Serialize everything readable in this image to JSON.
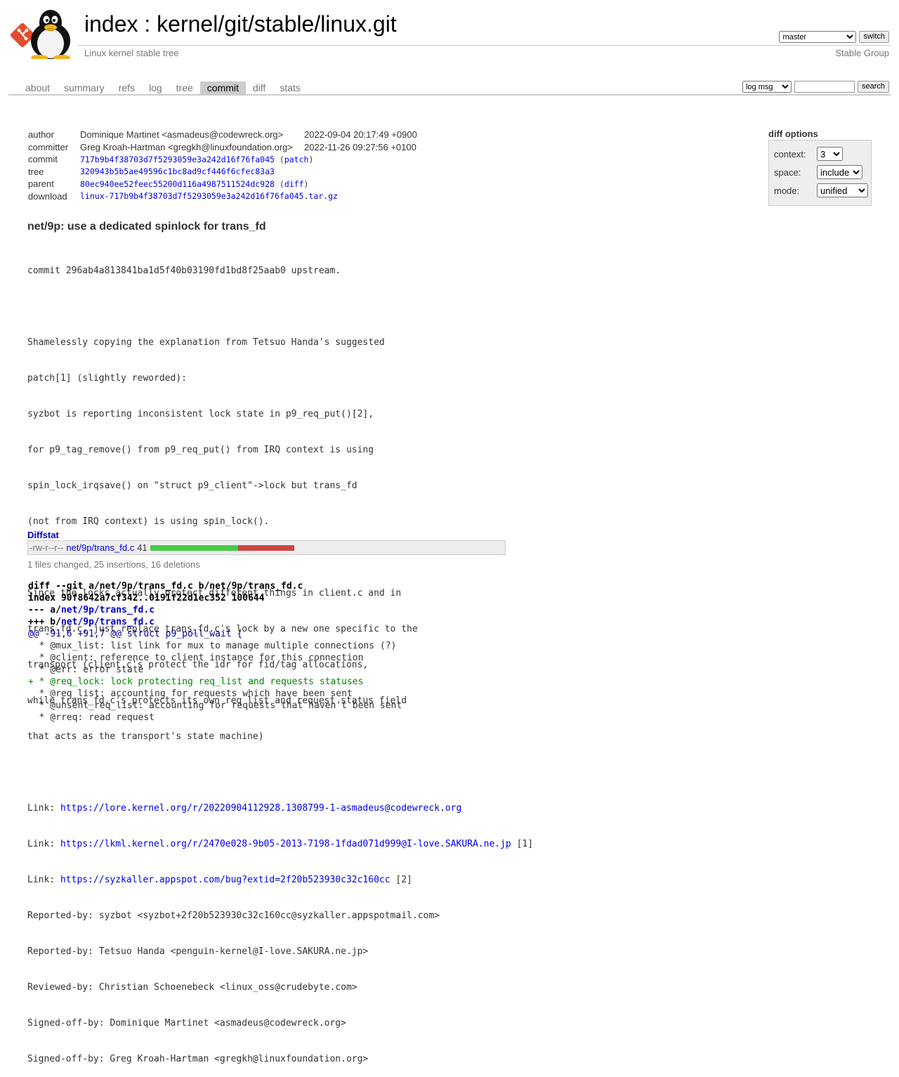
{
  "header": {
    "title_index": "index",
    "title_sep": " : ",
    "title_repo": "kernel/git/stable/linux.git",
    "subtitle": "Linux kernel stable tree",
    "owner": "Stable Group",
    "branch_selected": "master",
    "switch_label": "switch"
  },
  "tabs": [
    {
      "label": "about"
    },
    {
      "label": "summary"
    },
    {
      "label": "refs"
    },
    {
      "label": "log"
    },
    {
      "label": "tree"
    },
    {
      "label": "commit"
    },
    {
      "label": "diff"
    },
    {
      "label": "stats"
    }
  ],
  "active_tab": "commit",
  "search": {
    "mode_selected": "log msg",
    "query": "",
    "button_label": "search"
  },
  "commit_info": {
    "author_label": "author",
    "author": "Dominique Martinet <asmadeus@codewreck.org>",
    "author_date": "2022-09-04 20:17:49 +0900",
    "committer_label": "committer",
    "committer": "Greg Kroah-Hartman <gregkh@linuxfoundation.org>",
    "committer_date": "2022-11-26 09:27:56 +0100",
    "commit_label": "commit",
    "commit_sha": "717b9b4f38703d7f5293059e3a242d16f76fa045",
    "patch_link": "patch",
    "tree_label": "tree",
    "tree_sha": "320943b5b5ae49596c1bc8ad9cf446f6cfec83a3",
    "parent_label": "parent",
    "parent_sha": "80ec940ee52feec55200d116a4987511524dc928",
    "diff_link": "diff",
    "download_label": "download",
    "download_file": "linux-717b9b4f38703d7f5293059e3a242d16f76fa045.tar.gz"
  },
  "diff_options": {
    "title": "diff options",
    "context_label": "context:",
    "context_value": "3",
    "space_label": "space:",
    "space_value": "include",
    "mode_label": "mode:",
    "mode_value": "unified"
  },
  "message": {
    "subject": "net/9p: use a dedicated spinlock for trans_fd",
    "body_lines": [
      "commit 296ab4a813841ba1d5f40b03190fd1bd8f25aab0 upstream.",
      "",
      "Shamelessly copying the explanation from Tetsuo Handa's suggested",
      "patch[1] (slightly reworded):",
      "syzbot is reporting inconsistent lock state in p9_req_put()[2],",
      "for p9_tag_remove() from p9_req_put() from IRQ context is using",
      "spin_lock_irqsave() on \"struct p9_client\"->lock but trans_fd",
      "(not from IRQ context) is using spin_lock().",
      "",
      "Since the locks actually protect different things in client.c and in",
      "trans_fd.c, just replace trans_fd.c's lock by a new one specific to the",
      "transport (client.c's protect the idr for fid/tag allocations,",
      "while trans_fd.c's protects its own req list and request status field",
      "that acts as the transport's state machine)",
      ""
    ],
    "links": [
      {
        "prefix": "Link: ",
        "url": "https://lore.kernel.org/r/20220904112928.1308799-1-asmadeus@codewreck.org",
        "suffix": ""
      },
      {
        "prefix": "Link: ",
        "url": "https://lkml.kernel.org/r/2470e028-9b05-2013-7198-1fdad071d999@I-love.SAKURA.ne.jp",
        "suffix": " [1]"
      },
      {
        "prefix": "Link: ",
        "url": "https://syzkaller.appspot.com/bug?extid=2f20b523930c32c160cc",
        "suffix": " [2]"
      }
    ],
    "trailer_lines": [
      "Reported-by: syzbot <syzbot+2f20b523930c32c160cc@syzkaller.appspotmail.com>",
      "Reported-by: Tetsuo Handa <penguin-kernel@I-love.SAKURA.ne.jp>",
      "Reviewed-by: Christian Schoenebeck <linux_oss@crudebyte.com>",
      "Signed-off-by: Dominique Martinet <asmadeus@codewreck.org>",
      "Signed-off-by: Greg Kroah-Hartman <gregkh@linuxfoundation.org>"
    ]
  },
  "diffstat": {
    "header": "Diffstat",
    "mode": "-rw-r--r--",
    "file": "net/9p/trans_fd.c",
    "changes": "41",
    "insertions": 25,
    "deletions": 16,
    "summary": "1 files changed, 25 insertions, 16 deletions",
    "colors": {
      "insert": "#44cc44",
      "delete": "#cc4444"
    }
  },
  "diff": {
    "git_line": "diff --git a/net/9p/trans_fd.c b/net/9p/trans_fd.c",
    "index_line": "index 90f8642a7cf342..0191f22d1ec352 100644",
    "old_prefix": "--- a/",
    "new_prefix": "+++ b/",
    "file_path": "net/9p/trans_fd.c",
    "hunk": "@@ -91,6 +91,7 @@ struct p9_poll_wait {",
    "lines": [
      {
        "type": "ctx",
        "text": "  * @mux_list: list link for mux to manage multiple connections (?)"
      },
      {
        "type": "ctx",
        "text": "  * @client: reference to client instance for this connection"
      },
      {
        "type": "ctx",
        "text": "  * @err: error state"
      },
      {
        "type": "add",
        "text": "+ * @req_lock: lock protecting req_list and requests statuses"
      },
      {
        "type": "ctx",
        "text": "  * @req_list: accounting for requests which have been sent"
      },
      {
        "type": "ctx",
        "text": "  * @unsent_req_list: accounting for requests that haven't been sent"
      },
      {
        "type": "ctx",
        "text": "  * @rreq: read request"
      }
    ]
  }
}
